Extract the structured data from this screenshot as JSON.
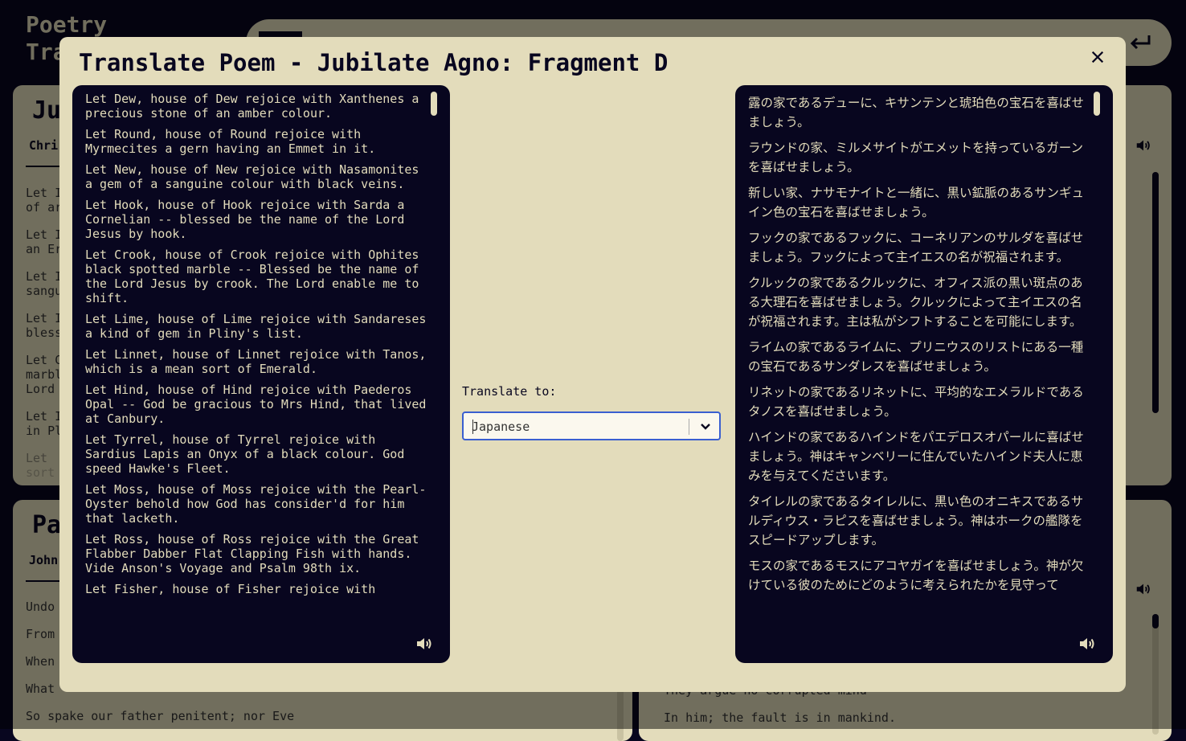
{
  "app": {
    "title_line1": "Poetry",
    "title_line2": "Tra"
  },
  "background_cards": [
    {
      "title": "Ju",
      "author": "Chri",
      "lines": [
        "Let I",
        "of ar",
        "Let I",
        "an Er",
        "Let I",
        "sangu",
        "Let I",
        "bless",
        "Let C",
        "marbl",
        "Lord",
        "Let I",
        "in Pl",
        "Let ",
        "sort"
      ]
    },
    {
      "title": "Pa",
      "author": "John",
      "lines": [
        "Undo",
        "From",
        "When",
        "What",
        "So spake our father penitent; nor Eve"
      ]
    },
    {
      "right_lines": [
        "They argue no corrupted mind",
        "In him; the fault is in mankind."
      ]
    }
  ],
  "modal": {
    "title": "Translate Poem - Jubilate Agno: Fragment D",
    "close_label": "×",
    "translate_label": "Translate to:",
    "language": "Japanese",
    "original_stanzas": [
      "Let Dew, house of Dew rejoice with Xanthenes a precious stone of an amber colour.",
      "Let Round, house of Round rejoice with Myrmecites a gern having an Emmet in it.",
      "Let New, house of New rejoice with Nasamonites a gem of a sanguine colour with black veins.",
      "Let Hook, house of Hook rejoice with Sarda a Cornelian -- blessed be the name of the Lord Jesus by hook.",
      "Let Crook, house of Crook rejoice with Ophites black spotted marble -- Blessed be the name of the Lord Jesus by crook. The Lord enable me to shift.",
      "Let Lime, house of Lime rejoice with Sandareses a kind of gem in Pliny's list.",
      "Let Linnet, house of Linnet rejoice with Tanos, which is a mean sort of Emerald.",
      "Let Hind, house of Hind rejoice with Paederos Opal -- God be gracious to Mrs Hind, that lived at Canbury.",
      "Let Tyrrel, house of Tyrrel rejoice with Sardius Lapis an Onyx of a black colour. God speed Hawke's Fleet.",
      "Let Moss, house of Moss rejoice with the Pearl-Oyster behold how God has consider'd for him that lacketh.",
      "Let Ross, house of Ross rejoice with the Great Flabber Dabber Flat Clapping Fish with hands. Vide Anson's Voyage and Psalm 98th ix.",
      "Let Fisher, house of Fisher rejoice with"
    ],
    "translated_stanzas": [
      "露の家であるデューに、キサンテンと琥珀色の宝石を喜ばせましょう。",
      "ラウンドの家、ミルメサイトがエメットを持っているガーンを喜ばせましょう。",
      "新しい家、ナサモナイトと一緒に、黒い鉱脈のあるサンギュイン色の宝石を喜ばせましょう。",
      "フックの家であるフックに、コーネリアンのサルダを喜ばせましょう。フックによって主イエスの名が祝福されます。",
      "クルックの家であるクルックに、オフィス派の黒い斑点のある大理石を喜ばせましょう。クルックによって主イエスの名が祝福されます。主は私がシフトすることを可能にします。",
      "ライムの家であるライムに、プリニウスのリストにある一種の宝石であるサンダレスを喜ばせましょう。",
      "リネットの家であるリネットに、平均的なエメラルドであるタノスを喜ばせましょう。",
      "ハインドの家であるハインドをパエデロスオパールに喜ばせましょう。神はキャンベリーに住んでいたハインド夫人に恵みを与えてくださいます。",
      "タイレルの家であるタイレルに、黒い色のオニキスであるサルディウス・ラピスを喜ばせましょう。神はホークの艦隊をスピードアップします。",
      "モスの家であるモスにアコヤガイを喜ばせましょう。神が欠けている彼のためにどのように考えられたかを見守って"
    ]
  }
}
